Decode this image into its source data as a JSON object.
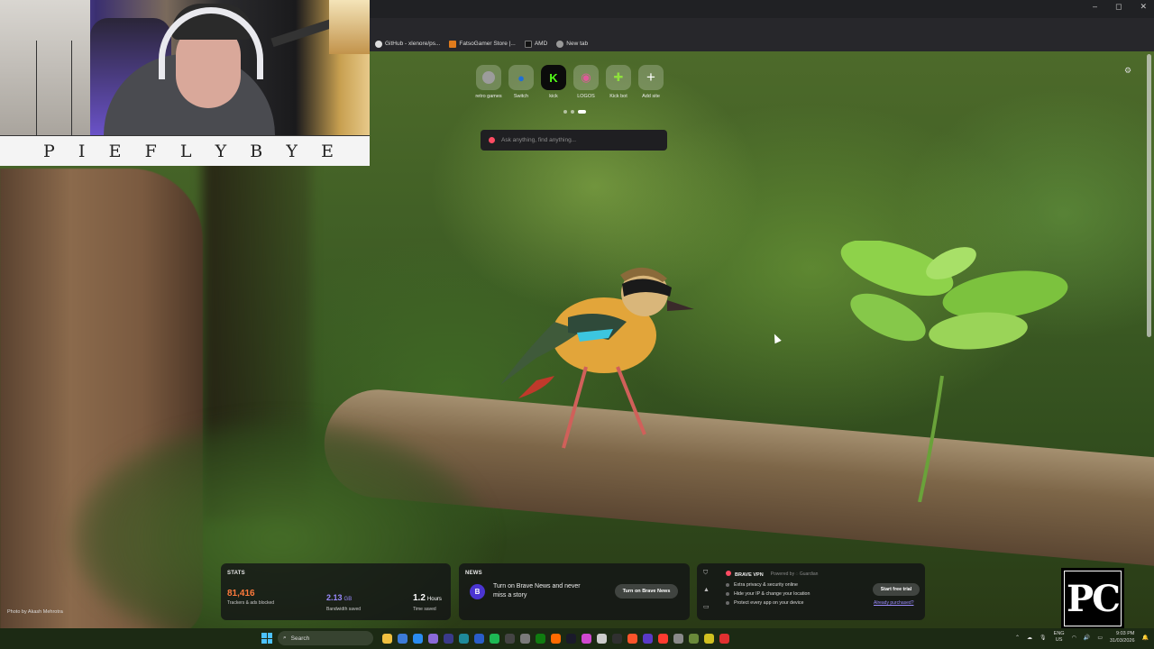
{
  "webcam": {
    "banner_letters": [
      "P",
      "I",
      "E",
      "F",
      "L",
      "Y",
      "B",
      "Y",
      "E"
    ]
  },
  "browser": {
    "window_controls": [
      "–",
      "◻",
      "✕"
    ],
    "bookmarks": [
      {
        "label": "GitHub - xlenore/ps...",
        "icon": "github-icon"
      },
      {
        "label": "FatsoGamer Store |...",
        "icon": "store-icon"
      },
      {
        "label": "AMD",
        "icon": "amd-icon"
      },
      {
        "label": "New tab",
        "icon": "globe-icon"
      }
    ]
  },
  "newtab": {
    "top_sites": [
      {
        "label": "retro games",
        "glyph": "",
        "color": "#9c9c9c"
      },
      {
        "label": "Switch",
        "glyph": "●",
        "color": "#1f6fd6"
      },
      {
        "label": "kick",
        "glyph": "K",
        "color": "#53fc18"
      },
      {
        "label": "LOGOS",
        "glyph": "◉",
        "color": "#e05a9a"
      },
      {
        "label": "Kick bot",
        "glyph": "✚",
        "color": "#8ee03c"
      },
      {
        "label": "Add site",
        "glyph": "+",
        "color": "#ffffff"
      }
    ],
    "search_placeholder": "Ask anything, find anything...",
    "photo_credit": "Photo by Akash Mehrotra"
  },
  "stats": {
    "heading": "STATS",
    "trackers": {
      "value": "81,416",
      "label": "Trackers & ads blocked"
    },
    "bandwidth": {
      "value": "2.13",
      "unit": "GB",
      "label": "Bandwidth saved"
    },
    "time": {
      "value": "1.2",
      "unit": "Hours",
      "label": "Time saved"
    }
  },
  "news": {
    "heading": "NEWS",
    "avatar": "B",
    "text": "Turn on Brave News and never miss a story",
    "button": "Turn on Brave News"
  },
  "vpn": {
    "title": "BRAVE VPN",
    "powered": "Powered by ◌ Guardian",
    "features": [
      "Extra privacy & security online",
      "Hide your IP & change your location",
      "Protect every app on your device"
    ],
    "button": "Start free trial",
    "link": "Already purchased?"
  },
  "logo": {
    "text": "PC"
  },
  "taskbar": {
    "search_label": "Search",
    "lang": "ENG",
    "region": "US",
    "time": "9:03 PM",
    "date": "31/03/2026",
    "app_colors": [
      "#f0c040",
      "#3c7bd8",
      "#2a8cf0",
      "#8a6ad8",
      "#3a3a8a",
      "#1e8a9a",
      "#2a5dc8",
      "#1db954",
      "#444444",
      "#7a7a7a",
      "#107c10",
      "#ff6a00",
      "#1a1a2a",
      "#d048d0",
      "#cccccc",
      "#303030",
      "#fb542b",
      "#5a3ac8",
      "#ff3b30",
      "#8a8a8a",
      "#6a8a3a",
      "#d0c020",
      "#e03030"
    ]
  }
}
